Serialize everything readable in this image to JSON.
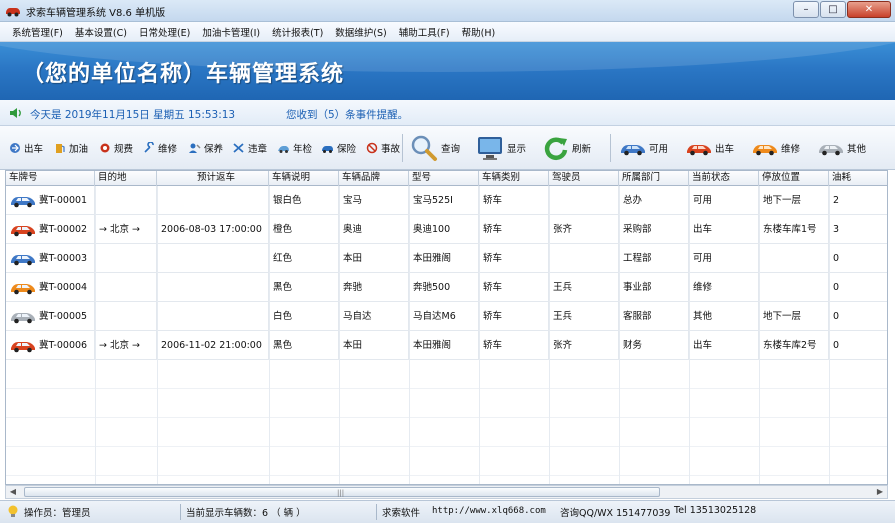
{
  "window": {
    "title": "求索车辆管理系统 V8.6 单机版",
    "controls": {
      "minimize": "–",
      "maximize": "□",
      "close": "✕"
    }
  },
  "menu": [
    "系统管理(F)",
    "基本设置(C)",
    "日常处理(E)",
    "加油卡管理(I)",
    "统计报表(T)",
    "数据维护(S)",
    "辅助工具(F)",
    "帮助(H)"
  ],
  "banner": {
    "title": "（您的单位名称）车辆管理系统",
    "color": "#2b77c5"
  },
  "notice": {
    "today": "今天是  2019年11月15日  星期五  15:53:13",
    "message": "您收到（5）条事件提醒。"
  },
  "toolbar": {
    "left": [
      {
        "label": "出车",
        "icon": "car-depart-icon"
      },
      {
        "label": "加油",
        "icon": "fuel-icon"
      },
      {
        "label": "规费",
        "icon": "fee-icon"
      },
      {
        "label": "维修",
        "icon": "wrench-icon"
      },
      {
        "label": "保养",
        "icon": "maintenance-icon"
      },
      {
        "label": "违章",
        "icon": "violation-icon"
      },
      {
        "label": "年检",
        "icon": "inspection-icon"
      },
      {
        "label": "保险",
        "icon": "insurance-icon"
      },
      {
        "label": "事故",
        "icon": "accident-icon"
      }
    ],
    "query": "查询",
    "display": "显示",
    "refresh": "刷新",
    "status_filters": [
      "可用",
      "出车",
      "维修",
      "其他"
    ]
  },
  "table": {
    "columns": [
      "车牌号",
      "目的地",
      "预计返车",
      "车辆说明",
      "车辆品牌",
      "型号",
      "车辆类别",
      "驾驶员",
      "所属部门",
      "当前状态",
      "停放位置",
      "油耗"
    ],
    "rows": [
      {
        "car_color": "blue",
        "plate": "冀T-00001",
        "destination": "",
        "return": "",
        "desc": "银白色",
        "brand": "宝马",
        "model": "宝马525I",
        "category": "轿车",
        "driver": "",
        "dept": "总办",
        "status": "可用",
        "location": "地下一层",
        "fuel": "2"
      },
      {
        "car_color": "red",
        "plate": "冀T-00002",
        "destination": "→ 北京 →",
        "return": "2006-08-03 17:00:00",
        "desc": "橙色",
        "brand": "奥迪",
        "model": "奥迪100",
        "category": "轿车",
        "driver": "张齐",
        "dept": "采购部",
        "status": "出车",
        "location": "东楼车库1号",
        "fuel": "3"
      },
      {
        "car_color": "blue",
        "plate": "冀T-00003",
        "destination": "",
        "return": "",
        "desc": "红色",
        "brand": "本田",
        "model": "本田雅阁",
        "category": "轿车",
        "driver": "",
        "dept": "工程部",
        "status": "可用",
        "location": "",
        "fuel": "0"
      },
      {
        "car_color": "orange",
        "plate": "冀T-00004",
        "destination": "",
        "return": "",
        "desc": "黑色",
        "brand": "奔驰",
        "model": "奔驰500",
        "category": "轿车",
        "driver": "王兵",
        "dept": "事业部",
        "status": "维修",
        "location": "",
        "fuel": "0"
      },
      {
        "car_color": "silver",
        "plate": "冀T-00005",
        "destination": "",
        "return": "",
        "desc": "白色",
        "brand": "马自达",
        "model": "马自达M6",
        "category": "轿车",
        "driver": "王兵",
        "dept": "客服部",
        "status": "其他",
        "location": "地下一层",
        "fuel": "0"
      },
      {
        "car_color": "red",
        "plate": "冀T-00006",
        "destination": "→ 北京 →",
        "return": "2006-11-02 21:00:00",
        "desc": "黑色",
        "brand": "本田",
        "model": "本田雅阁",
        "category": "轿车",
        "driver": "张齐",
        "dept": "财务",
        "status": "出车",
        "location": "东楼车库2号",
        "fuel": "0"
      }
    ]
  },
  "statusbar": {
    "operator": "操作员：管理员",
    "count": "当前显示车辆数：6 （ 辆 ）",
    "vendor": "求索软件",
    "url": "http://www.xlq668.com",
    "qq": "咨询QQ/WX 151477039",
    "tel": "Tel 13513025128"
  },
  "colors": {
    "car_blue": "#3f78c6",
    "car_red": "#d8431f",
    "car_orange": "#ee8a1c",
    "car_silver": "#a9b0b8"
  }
}
